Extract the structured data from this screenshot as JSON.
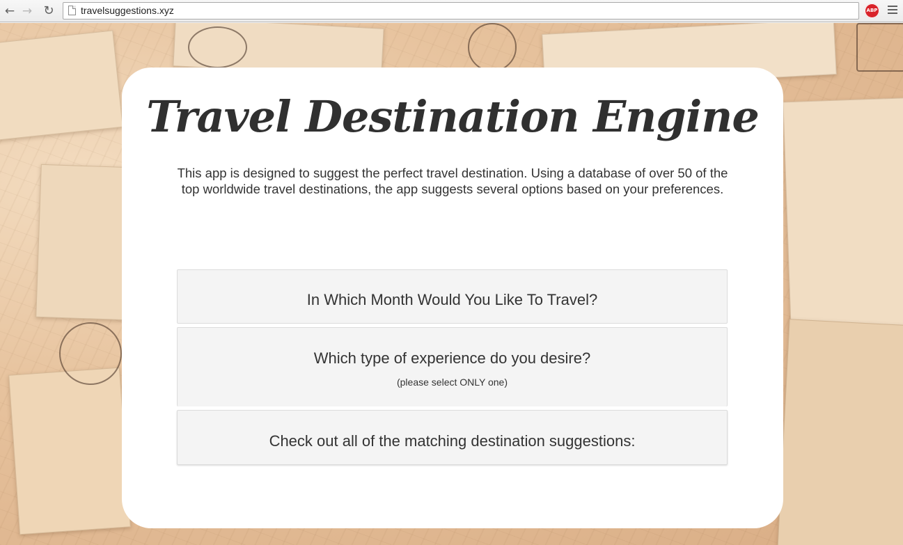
{
  "browser": {
    "url": "travelsuggestions.xyz",
    "back_icon": "arrow-left-icon",
    "forward_icon": "arrow-right-icon",
    "reload_icon": "reload-icon",
    "extension_label": "ABP",
    "menu_icon": "hamburger-menu-icon"
  },
  "page": {
    "title": "Travel Destination Engine",
    "intro": "This app is designed to suggest the perfect travel destination. Using a database of over 50 of the top worldwide travel destinations, the app suggests several options based on your preferences."
  },
  "sections": {
    "month": {
      "heading": "In Which Month Would You Like To Travel?"
    },
    "experience": {
      "heading": "Which type of experience do you desire?",
      "note": "(please select ONLY one)"
    },
    "results": {
      "heading": "Check out all of the matching destination suggestions:"
    }
  },
  "colors": {
    "panel_background": "#ffffff",
    "section_background": "#f4f4f4",
    "text": "#333333",
    "abp_red": "#d9232a"
  }
}
